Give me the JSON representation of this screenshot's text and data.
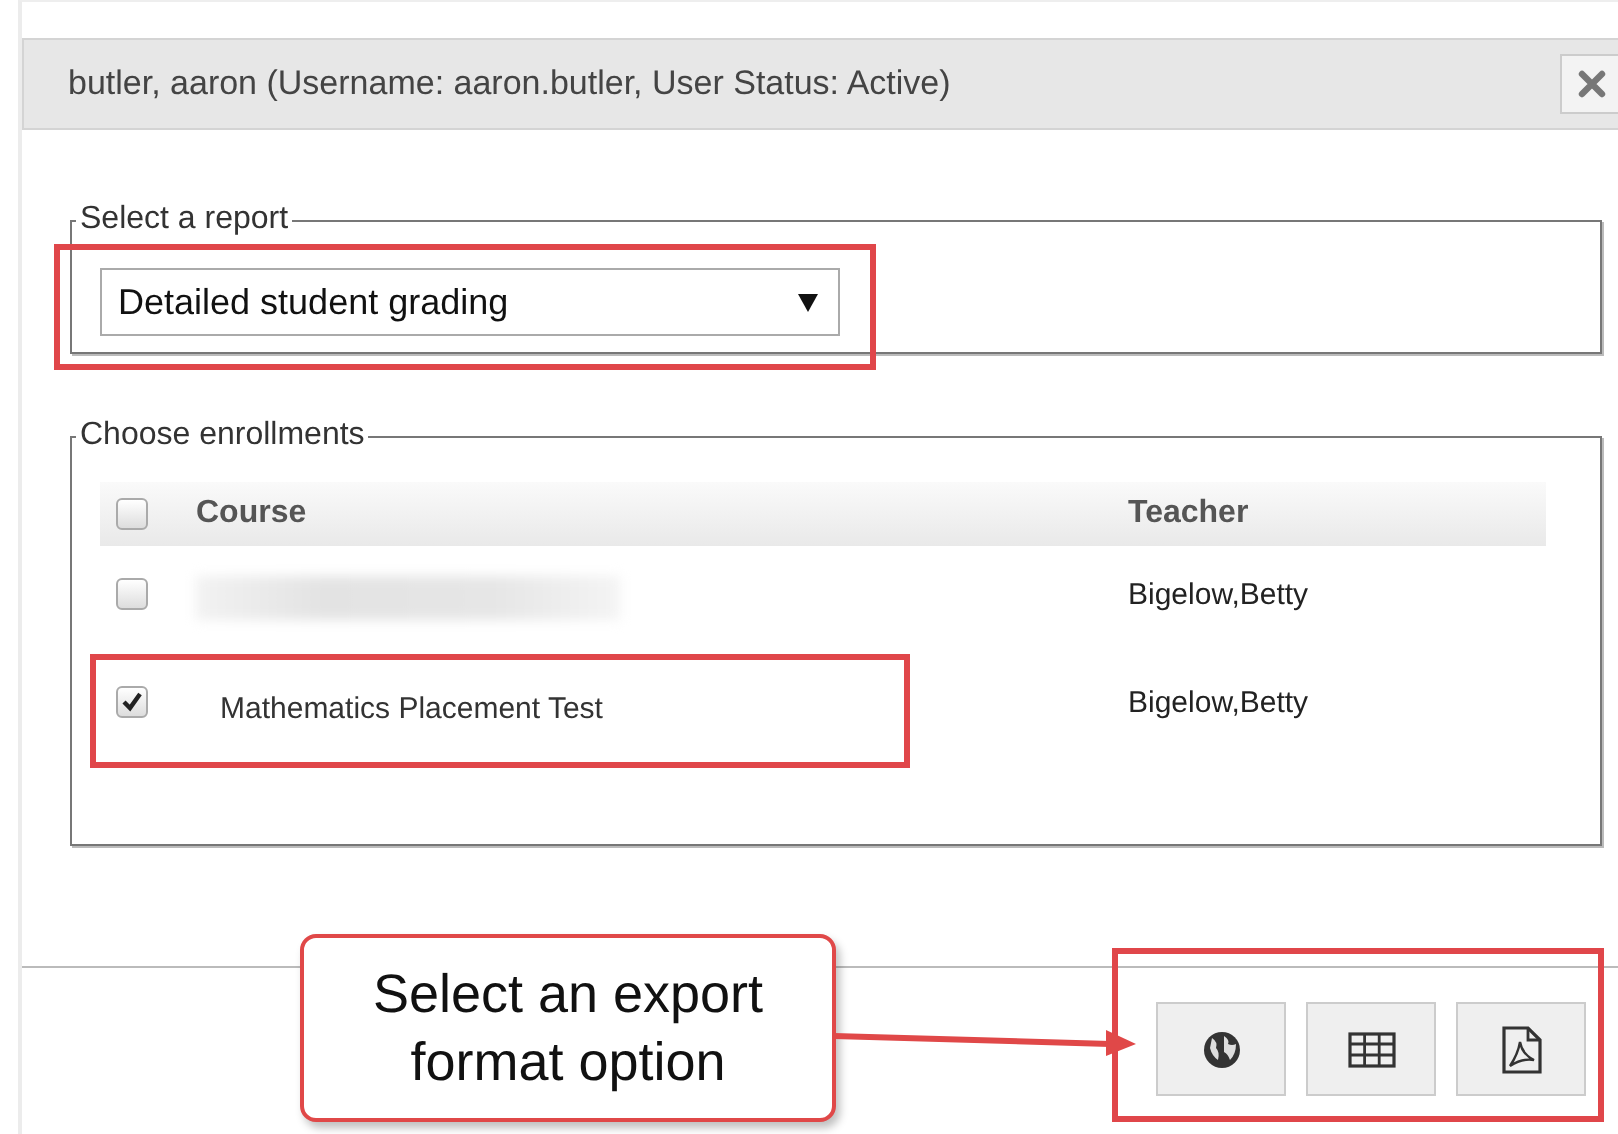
{
  "dialog": {
    "title": "butler, aaron (Username: aaron.butler, User Status: Active)"
  },
  "report": {
    "legend": "Select a report",
    "value": "Detailed student grading"
  },
  "enrollments": {
    "legend": "Choose enrollments",
    "columns": [
      "Course",
      "Teacher"
    ],
    "select_all": {
      "checked": false
    },
    "rows": [
      {
        "checked": false,
        "teacher": "Bigelow,Betty"
      },
      {
        "checked": true,
        "course": "Mathematics Placement Test",
        "teacher": "Bigelow,Betty"
      }
    ]
  },
  "export_buttons": [
    {
      "kind": "web"
    },
    {
      "kind": "table"
    },
    {
      "kind": "pdf"
    }
  ],
  "callout": {
    "text": "Select an export format option"
  }
}
